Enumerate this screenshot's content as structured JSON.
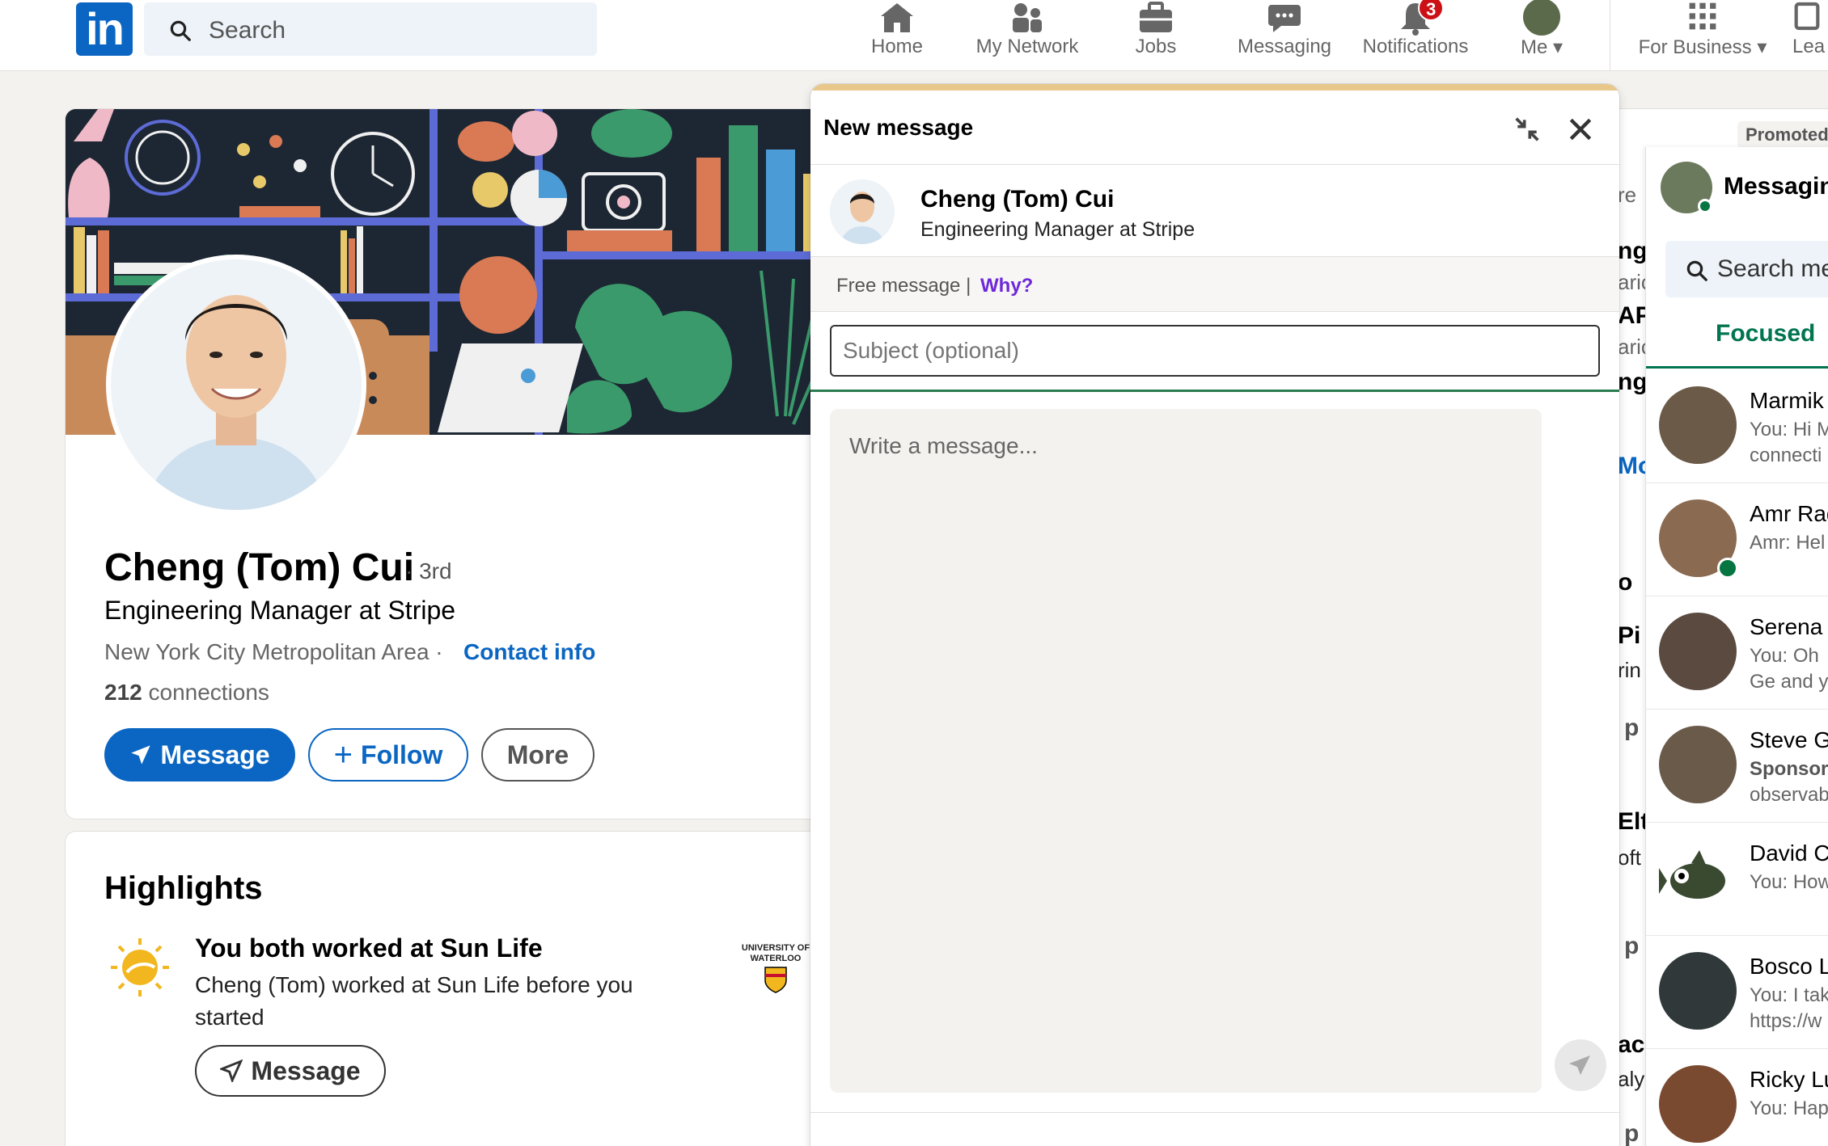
{
  "nav": {
    "logo": "in",
    "search_placeholder": "Search",
    "items": [
      {
        "label": "Home",
        "icon": "home-icon"
      },
      {
        "label": "My Network",
        "icon": "network-icon"
      },
      {
        "label": "Jobs",
        "icon": "briefcase-icon"
      },
      {
        "label": "Messaging",
        "icon": "chat-icon"
      },
      {
        "label": "Notifications",
        "icon": "bell-icon",
        "badge": "3"
      },
      {
        "label": "Me",
        "icon": "avatar"
      },
      {
        "label": "For Business",
        "icon": "grid-icon"
      },
      {
        "label": "Lea",
        "icon": "document-icon"
      }
    ]
  },
  "profile": {
    "name": "Cheng (Tom) Cui",
    "degree": "· 3rd",
    "headline": "Engineering Manager at Stripe",
    "location": "New York City Metropolitan Area ·",
    "contact_label": "Contact info",
    "connections_count": "212",
    "connections_label": "connections",
    "message_label": "Message",
    "follow_label": "Follow",
    "more_label": "More"
  },
  "highlights": {
    "title": "Highlights",
    "heading": "You both worked at Sun Life",
    "body": "Cheng (Tom) worked at Sun Life before you started",
    "message_label": "Message",
    "school_logo_text": "UNIVERSITY OF WATERLOO"
  },
  "background_fragments": {
    "promoted": "Promoted",
    "texts": [
      "re",
      "ng",
      "aric",
      "AP",
      "aric",
      "ng",
      "Mo",
      "o",
      "Pi",
      "rin",
      "p",
      "Elt",
      "oft",
      "p",
      "ac",
      "aly",
      "p"
    ]
  },
  "messaging_panel": {
    "title": "Messagin",
    "search_placeholder": "Search me",
    "tab_focused": "Focused",
    "conversations": [
      {
        "name": "Marmik",
        "preview": "You: Hi M",
        "preview2": "connecti",
        "color": "#6b5a48",
        "online": false
      },
      {
        "name": "Amr Rad",
        "preview": "Amr: Hel",
        "preview2": "",
        "color": "#8a6a50",
        "online": true
      },
      {
        "name": "Serena",
        "preview": "You: Oh",
        "preview2": "Ge and y",
        "color": "#5a4a40",
        "online": false
      },
      {
        "name": "Steve G",
        "preview": "Sponsor",
        "preview2": "observab",
        "color": "#6a5a4a",
        "online": false
      },
      {
        "name": "David C",
        "preview": "You: How",
        "preview2": "",
        "color": "#3a4a30",
        "online": false
      },
      {
        "name": "Bosco L",
        "preview": "You: I tak",
        "preview2": "https://w",
        "color": "#30383a",
        "online": false
      },
      {
        "name": "Ricky Lu",
        "preview": "You: Hap",
        "preview2": "",
        "color": "#7a4a30",
        "online": false
      }
    ]
  },
  "compose": {
    "title": "New message",
    "recipient_name": "Cheng (Tom) Cui",
    "recipient_headline": "Engineering Manager at Stripe",
    "free_message": "Free message |",
    "why": "Why?",
    "subject_placeholder": "Subject (optional)",
    "body_placeholder": "Write a message..."
  },
  "colors": {
    "brand": "#0a66c2",
    "accent_green": "#01754f",
    "badge_red": "#cc1016"
  }
}
